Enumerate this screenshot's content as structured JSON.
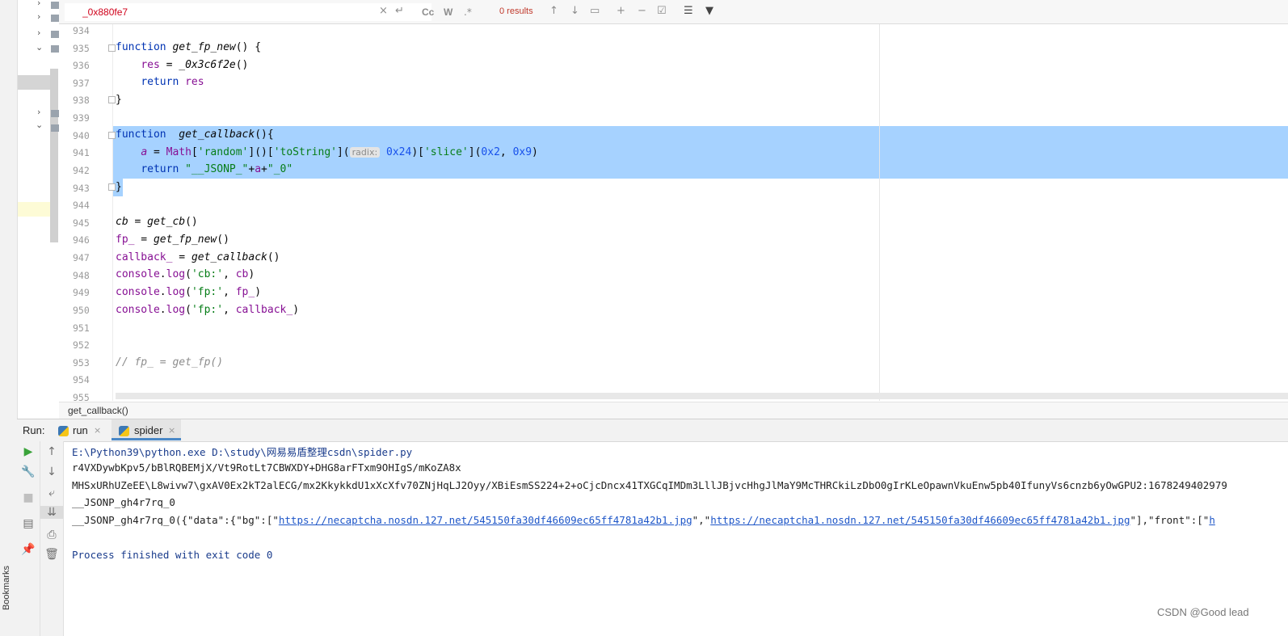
{
  "search": {
    "query": "_0x880fe7",
    "results": "0 results",
    "case_label": "Cc",
    "word_label": "W",
    "regex_label": ".*"
  },
  "editor": {
    "line_numbers": [
      "934",
      "935",
      "936",
      "937",
      "938",
      "939",
      "940",
      "941",
      "942",
      "943",
      "944",
      "945",
      "946",
      "947",
      "948",
      "949",
      "950",
      "951",
      "952",
      "953",
      "954",
      "955"
    ],
    "param_hint": "radix:"
  },
  "breadcrumb": {
    "text": "get_callback()"
  },
  "run": {
    "label": "Run:",
    "tabs": [
      {
        "label": "run"
      },
      {
        "label": "spider"
      }
    ]
  },
  "console": {
    "lines": [
      "E:\\Python39\\python.exe D:\\study\\网易易盾整理csdn\\spider.py",
      "r4VXDywbKpv5/bBlRQBEMjX/Vt9RotLt7CBWXDY+DHG8arFTxm9OHIgS/mKoZA8x",
      "MHSxURhUZeEE\\L8wivw7\\gxAV0Ex2kT2alECG/mx2KkykkdU1xXcXfv70ZNjHqLJ2Oyy/XBiEsmSS224+2+oCjcDncx41TXGCqIMDm3LllJBjvcHhgJlMaY9McTHRCkiLzDbO0gIrKLeOpawnVkuEnw5pb40IfunyVs6cnzb6yOwGPU2:1678249402979",
      "__JSONP_gh4r7rq_0",
      "Process finished with exit code 0"
    ],
    "json_prefix": "__JSONP_gh4r7rq_0({\"data\":{\"bg\":[\"",
    "json_link1": "https://necaptcha.nosdn.127.net/545150fa30df46609ec65ff4781a42b1.jpg",
    "json_mid": "\",\"",
    "json_link2": "https://necaptcha1.nosdn.127.net/545150fa30df46609ec65ff4781a42b1.jpg",
    "json_suffix": "\"],\"front\":[\"",
    "json_tail": "h"
  },
  "sidebar": {
    "bookmarks_label": "Bookmarks"
  },
  "watermark": "CSDN @Good lead"
}
